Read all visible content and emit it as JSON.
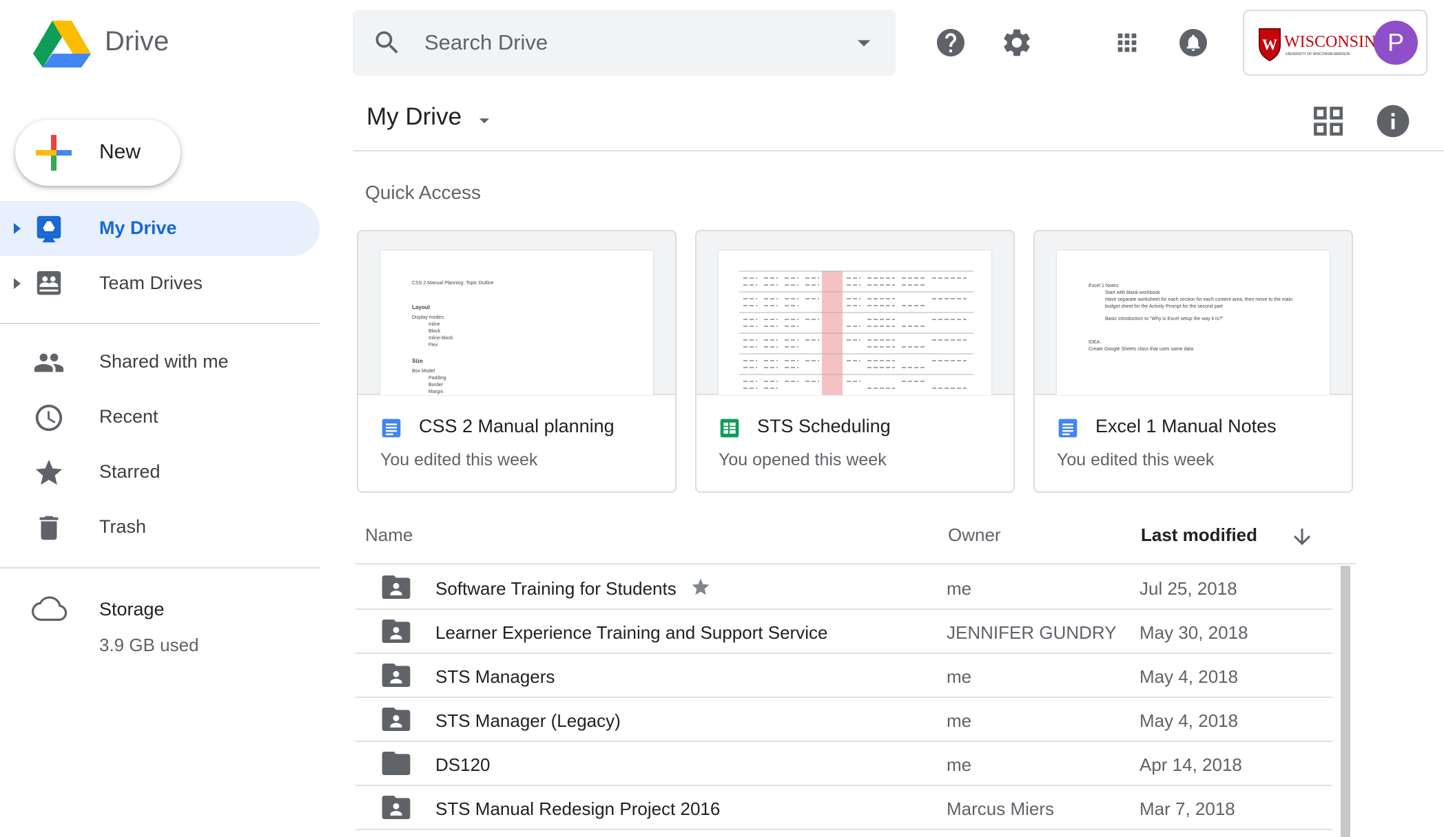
{
  "app": {
    "title": "Drive"
  },
  "search": {
    "placeholder": "Search Drive"
  },
  "account": {
    "org": "WISCONSIN",
    "org_sub": "UNIVERSITY OF WISCONSIN-MADISON",
    "initial": "P"
  },
  "sidebar": {
    "new_label": "New",
    "items": [
      {
        "label": "My Drive"
      },
      {
        "label": "Team Drives"
      },
      {
        "label": "Shared with me"
      },
      {
        "label": "Recent"
      },
      {
        "label": "Starred"
      },
      {
        "label": "Trash"
      }
    ],
    "storage": {
      "label": "Storage",
      "used": "3.9 GB used"
    }
  },
  "main": {
    "title": "My Drive",
    "quick_access_title": "Quick Access",
    "quick_access": [
      {
        "name": "CSS 2 Manual planning",
        "subtitle": "You edited this week",
        "type": "doc"
      },
      {
        "name": "STS Scheduling",
        "subtitle": "You opened this week",
        "type": "sheet"
      },
      {
        "name": "Excel 1 Manual Notes",
        "subtitle": "You edited this week",
        "type": "doc"
      }
    ],
    "thumb_css": {
      "heading": "CSS 2 Manual Planning: Topic Outline",
      "layout": "Layout",
      "display": "Display modes:",
      "items": [
        "Inline",
        "Block",
        "Inline-block",
        "Flex"
      ],
      "size": "Size",
      "box": "Box Model",
      "box_items": [
        "Padding",
        "Border",
        "Margin"
      ]
    },
    "thumb_excel": {
      "heading": "Excel 1 Notes:",
      "line1": "Start with blank workbook",
      "line2": "Have separate worksheet for each section for each content area, then move to the main",
      "line3": "budget sheet for the Activity Prompt for the second part",
      "line4": "Basic introduction to \"Why is Excel setup the way it is?\"",
      "idea": "IDEA:",
      "line5": "Create Google Sheets class that uses same data"
    },
    "columns": {
      "name": "Name",
      "owner": "Owner",
      "modified": "Last modified"
    },
    "files": [
      {
        "name": "Software Training for Students",
        "owner": "me",
        "modified": "Jul 25, 2018",
        "starred": true,
        "shared": true
      },
      {
        "name": "Learner Experience Training and Support Service",
        "owner": "JENNIFER GUNDRY",
        "modified": "May 30, 2018",
        "starred": false,
        "shared": true
      },
      {
        "name": "STS Managers",
        "owner": "me",
        "modified": "May 4, 2018",
        "starred": false,
        "shared": true
      },
      {
        "name": "STS Manager (Legacy)",
        "owner": "me",
        "modified": "May 4, 2018",
        "starred": false,
        "shared": true
      },
      {
        "name": "DS120",
        "owner": "me",
        "modified": "Apr 14, 2018",
        "starred": false,
        "shared": false
      },
      {
        "name": "STS Manual Redesign Project 2016",
        "owner": "Marcus Miers",
        "modified": "Mar 7, 2018",
        "starred": false,
        "shared": true
      }
    ]
  },
  "colors": {
    "accent": "#1967d2",
    "active_bg": "#e8f0fe",
    "avatar": "#8e4fc9",
    "doc_blue": "#4285f4",
    "sheet_green": "#0f9d58",
    "icon_gray": "#5f6368",
    "brand_red": "#c5050c"
  },
  "icons": [
    "drive-logo",
    "search-icon",
    "dropdown-icon",
    "help-icon",
    "settings-icon",
    "apps-icon",
    "notifications-icon",
    "new-plus-icon",
    "my-drive-icon",
    "team-drives-icon",
    "people-icon",
    "clock-icon",
    "star-icon",
    "trash-icon",
    "cloud-icon",
    "grid-view-icon",
    "info-icon",
    "doc-icon",
    "sheet-icon",
    "folder-icon",
    "shared-folder-icon",
    "arrow-down-icon"
  ]
}
